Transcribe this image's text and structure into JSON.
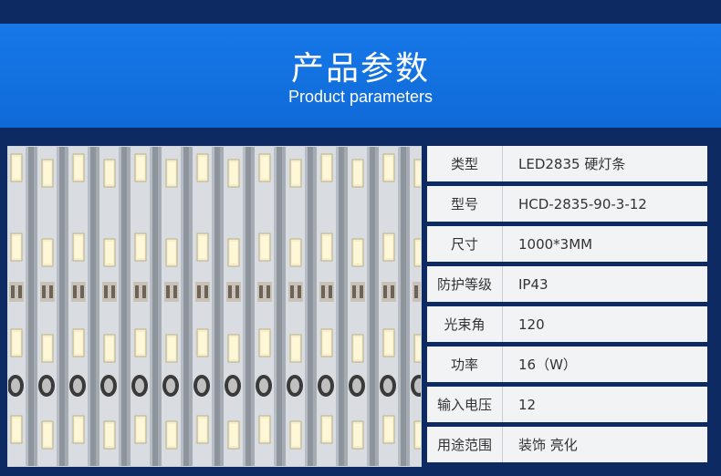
{
  "header": {
    "title": "产品参数",
    "subtitle": "Product parameters"
  },
  "photo": {
    "description_icon": "led-strip-photo"
  },
  "specs": [
    {
      "label": "类型",
      "value": "LED2835 硬灯条"
    },
    {
      "label": "型号",
      "value": "HCD-2835-90-3-12"
    },
    {
      "label": "尺寸",
      "value": "1000*3MM"
    },
    {
      "label": "防护等级",
      "value": "IP43"
    },
    {
      "label": "光束角",
      "value": "120"
    },
    {
      "label": "功率",
      "value": "16（W）"
    },
    {
      "label": "输入电压",
      "value": "12"
    },
    {
      "label": "用途范围",
      "value": "装饰 亮化"
    }
  ],
  "colors": {
    "background": "#0d2a63",
    "banner": "#1778e8",
    "row_bg": "#f2f3f5"
  }
}
